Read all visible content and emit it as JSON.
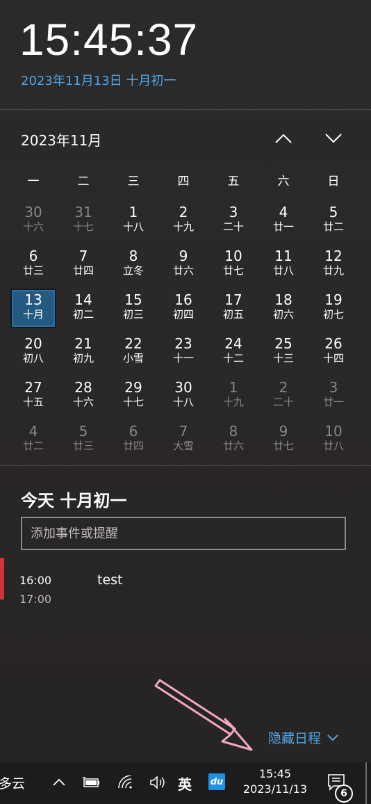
{
  "clock": {
    "time": "15:45:37",
    "date_link": "2023年11月13日 十月初一"
  },
  "calendar": {
    "month_title": "2023年11月",
    "weekdays": [
      "一",
      "二",
      "三",
      "四",
      "五",
      "六",
      "日"
    ],
    "days": [
      {
        "num": "30",
        "lunar": "十六",
        "dim": true
      },
      {
        "num": "31",
        "lunar": "十七",
        "dim": true
      },
      {
        "num": "1",
        "lunar": "十八"
      },
      {
        "num": "2",
        "lunar": "十九"
      },
      {
        "num": "3",
        "lunar": "二十"
      },
      {
        "num": "4",
        "lunar": "廿一"
      },
      {
        "num": "5",
        "lunar": "廿二"
      },
      {
        "num": "6",
        "lunar": "廿三"
      },
      {
        "num": "7",
        "lunar": "廿四"
      },
      {
        "num": "8",
        "lunar": "立冬"
      },
      {
        "num": "9",
        "lunar": "廿六"
      },
      {
        "num": "10",
        "lunar": "廿七"
      },
      {
        "num": "11",
        "lunar": "廿八"
      },
      {
        "num": "12",
        "lunar": "廿九"
      },
      {
        "num": "13",
        "lunar": "十月",
        "today": true
      },
      {
        "num": "14",
        "lunar": "初二"
      },
      {
        "num": "15",
        "lunar": "初三"
      },
      {
        "num": "16",
        "lunar": "初四"
      },
      {
        "num": "17",
        "lunar": "初五"
      },
      {
        "num": "18",
        "lunar": "初六"
      },
      {
        "num": "19",
        "lunar": "初七"
      },
      {
        "num": "20",
        "lunar": "初八"
      },
      {
        "num": "21",
        "lunar": "初九"
      },
      {
        "num": "22",
        "lunar": "小雪"
      },
      {
        "num": "23",
        "lunar": "十一"
      },
      {
        "num": "24",
        "lunar": "十二"
      },
      {
        "num": "25",
        "lunar": "十三"
      },
      {
        "num": "26",
        "lunar": "十四"
      },
      {
        "num": "27",
        "lunar": "十五"
      },
      {
        "num": "28",
        "lunar": "十六"
      },
      {
        "num": "29",
        "lunar": "十七"
      },
      {
        "num": "30",
        "lunar": "十八"
      },
      {
        "num": "1",
        "lunar": "十九",
        "dim": true
      },
      {
        "num": "2",
        "lunar": "二十",
        "dim": true
      },
      {
        "num": "3",
        "lunar": "廿一",
        "dim": true
      },
      {
        "num": "4",
        "lunar": "廿二",
        "dim": true
      },
      {
        "num": "5",
        "lunar": "廿三",
        "dim": true
      },
      {
        "num": "6",
        "lunar": "廿四",
        "dim": true
      },
      {
        "num": "7",
        "lunar": "大雪",
        "dim": true
      },
      {
        "num": "8",
        "lunar": "廿六",
        "dim": true
      },
      {
        "num": "9",
        "lunar": "廿七",
        "dim": true
      },
      {
        "num": "10",
        "lunar": "廿八",
        "dim": true
      }
    ]
  },
  "agenda": {
    "title": "今天 十月初一",
    "add_placeholder": "添加事件或提醒",
    "events": [
      {
        "start": "16:00",
        "end": "17:00",
        "title": "test",
        "color": "#d13438"
      }
    ],
    "hide_link": "隐藏日程"
  },
  "taskbar": {
    "weather": "多云",
    "lang": "英",
    "du_label": "du",
    "time": "15:45",
    "date": "2023/11/13",
    "notification_count": "6",
    "icons": [
      "chevron-up-icon",
      "battery-icon",
      "wifi-icon",
      "volume-icon",
      "baidu-input-icon",
      "notification-icon"
    ]
  },
  "colors": {
    "accent": "#4ea6e8",
    "today_bg": "#245a80",
    "event": "#d13438"
  }
}
